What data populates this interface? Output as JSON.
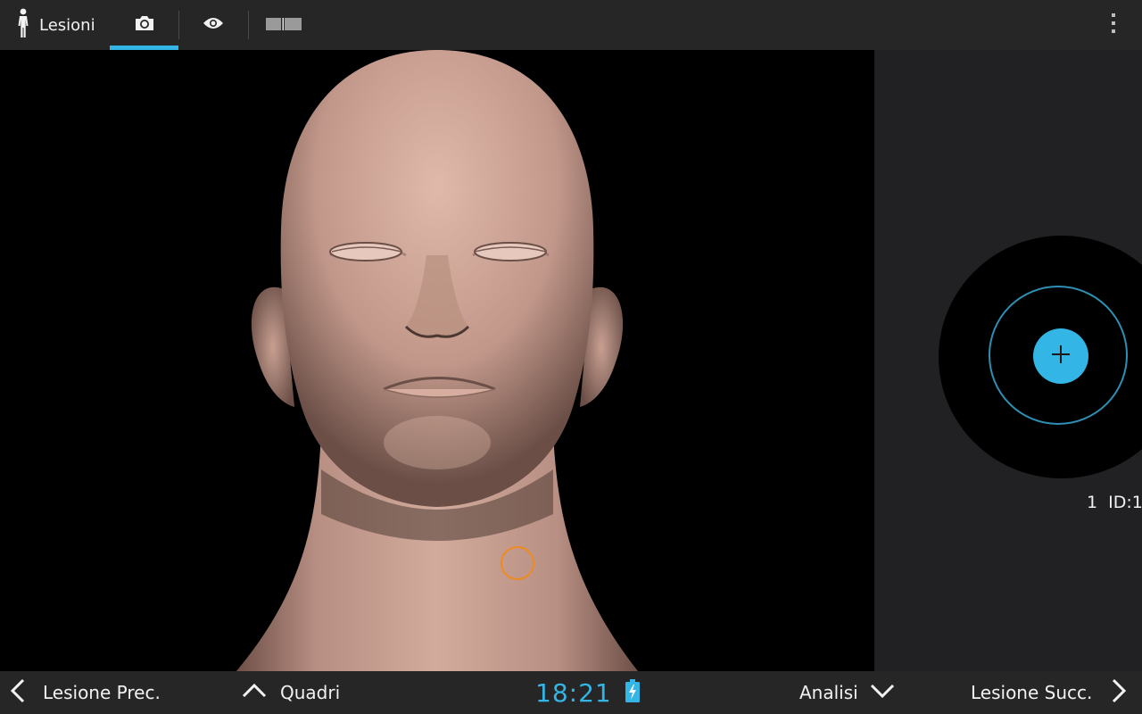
{
  "topbar": {
    "title": "Lesioni",
    "person_icon": "person-icon",
    "tabs": [
      {
        "icon": "camera-icon",
        "selected": true
      },
      {
        "icon": "eye-icon",
        "selected": false
      },
      {
        "icon": "split-view-icon",
        "selected": false
      }
    ],
    "overflow_icon": "overflow-menu-icon"
  },
  "side_panel": {
    "add_icon": "plus-icon",
    "lesion_number": "1",
    "lesion_id": "ID:1"
  },
  "bottombar": {
    "prev_label": "Lesione Prec.",
    "quadri_label": "Quadri",
    "time": "18:21",
    "analisi_label": "Analisi",
    "next_label": "Lesione Succ."
  },
  "colors": {
    "accent": "#33b5e5",
    "marker": "#f08a1c",
    "skin": "#c4998a",
    "bar": "#262626"
  }
}
